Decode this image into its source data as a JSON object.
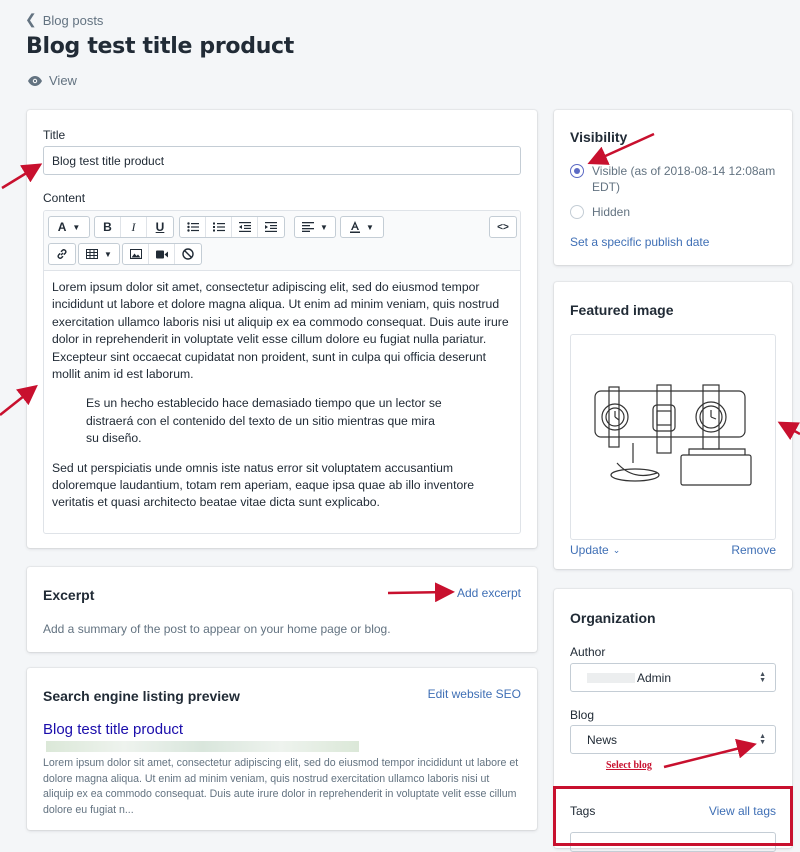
{
  "header": {
    "back_label": "Blog posts",
    "title": "Blog test title product",
    "view_label": "View"
  },
  "main": {
    "title_label": "Title",
    "title_value": "Blog test title product",
    "content_label": "Content",
    "toolbar": {
      "font_label": "A",
      "bold": "B",
      "italic": "I",
      "underline": "U",
      "code": "<>"
    },
    "content_paragraph_1": "Lorem ipsum dolor sit amet, consectetur adipiscing elit, sed do eiusmod tempor incididunt ut labore et dolore magna aliqua. Ut enim ad minim veniam, quis nostrud exercitation ullamco laboris nisi ut aliquip ex ea commodo consequat. Duis aute irure dolor in reprehenderit in voluptate velit esse cillum dolore eu fugiat nulla pariatur. Excepteur sint occaecat cupidatat non proident, sunt in culpa qui officia deserunt mollit anim id est laborum.",
    "content_quote": "Es un hecho establecido hace demasiado tiempo que un lector se distraerá con el contenido del texto de un sitio mientras que mira su diseño.",
    "content_paragraph_2": "Sed ut perspiciatis unde omnis iste natus error sit voluptatem accusantium doloremque laudantium, totam rem aperiam, eaque ipsa quae ab illo inventore veritatis et quasi architecto beatae vitae dicta sunt explicabo."
  },
  "excerpt": {
    "title": "Excerpt",
    "add_link": "Add excerpt",
    "help": "Add a summary of the post to appear on your home page or blog."
  },
  "seo": {
    "title": "Search engine listing preview",
    "edit_link": "Edit website SEO",
    "preview_title": "Blog test title product",
    "preview_description": "Lorem ipsum dolor sit amet, consectetur adipiscing elit, sed do eiusmod tempor incididunt ut labore et dolore magna aliqua. Ut enim ad minim veniam, quis nostrud exercitation ullamco laboris nisi ut aliquip ex ea commodo consequat. Duis aute irure dolor in reprehenderit in voluptate velit esse cillum dolore eu fugiat n..."
  },
  "visibility": {
    "title": "Visibility",
    "visible_label": "Visible (as of 2018-08-14 12:08am EDT)",
    "hidden_label": "Hidden",
    "publish_link": "Set a specific publish date"
  },
  "featured_image": {
    "title": "Featured image",
    "update_link": "Update",
    "remove_link": "Remove"
  },
  "organization": {
    "title": "Organization",
    "author_label": "Author",
    "author_value": "Admin",
    "blog_label": "Blog",
    "blog_value": "News",
    "annotation": "Select blog"
  },
  "tags": {
    "title": "Tags",
    "view_all_link": "View all tags"
  },
  "colors": {
    "accent": "#5c6ac4",
    "link": "#3f6fb5",
    "annotation_red": "#c8102e",
    "seo_title": "#1a0dab"
  }
}
